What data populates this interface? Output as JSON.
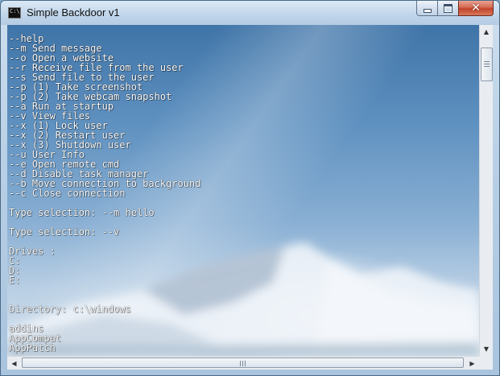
{
  "window": {
    "title": "Simple Backdoor v1",
    "icon_text": "C:\\_"
  },
  "console": {
    "lines": [
      "--help",
      "--m Send message",
      "--o Open a website",
      "--r Receive file from the user",
      "--s Send file to the user",
      "--p (1) Take screenshot",
      "--p (2) Take webcam snapshot",
      "--a Run at startup",
      "--v View files",
      "--x (1) Lock user",
      "--x (2) Restart user",
      "--x (3) Shutdown user",
      "--u User Info",
      "--e Open remote cmd",
      "--d Disable task manager",
      "--b Move connection to background",
      "--c Close connection",
      "",
      "Type selection: --m hello",
      "",
      "Type selection: --v",
      "",
      "Drives :",
      "C:",
      "D:",
      "E:",
      "",
      "",
      "Directory: c:\\windows",
      "",
      "addins",
      "AppCompat",
      "AppPatch"
    ]
  },
  "scrollbars": {
    "vertical_up_icon": "triangle-up",
    "vertical_down_icon": "triangle-down",
    "horizontal_left_icon": "triangle-left",
    "horizontal_right_icon": "triangle-right"
  },
  "colors": {
    "console_text": "#ffffff",
    "close_button": "#c2442a"
  }
}
